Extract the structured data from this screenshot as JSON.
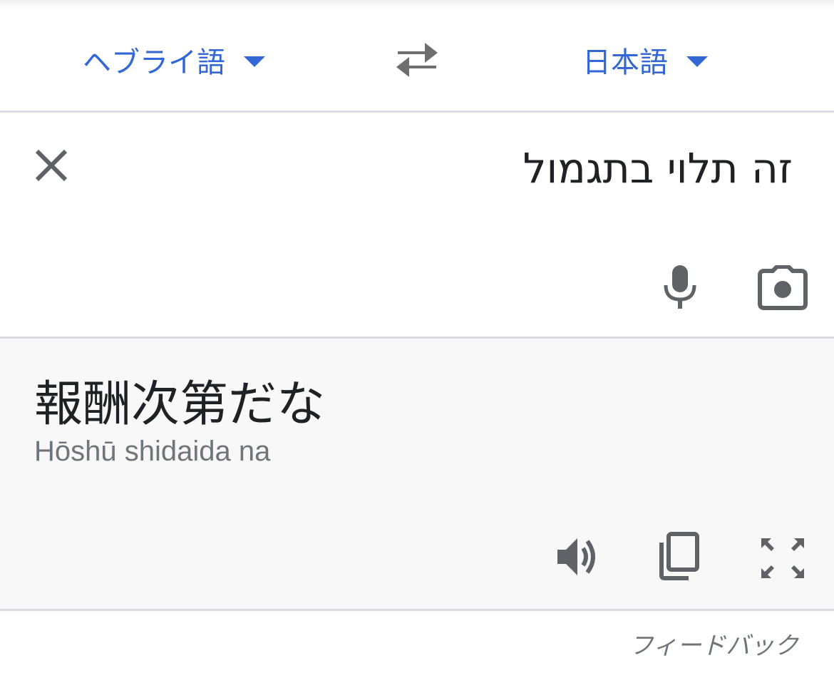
{
  "language_bar": {
    "source_language": "ヘブライ語",
    "target_language": "日本語",
    "accent_color": "#3367d6"
  },
  "input": {
    "source_text": "זה תלוי בתגמול",
    "icons": [
      "close-icon",
      "microphone-icon",
      "camera-icon"
    ]
  },
  "output": {
    "translated_text": "報酬次第だな",
    "romanization": "Hōshū shidaida na",
    "icons": [
      "speaker-icon",
      "copy-icon",
      "fullscreen-icon"
    ]
  },
  "footer": {
    "feedback_label": "フィードバック"
  }
}
